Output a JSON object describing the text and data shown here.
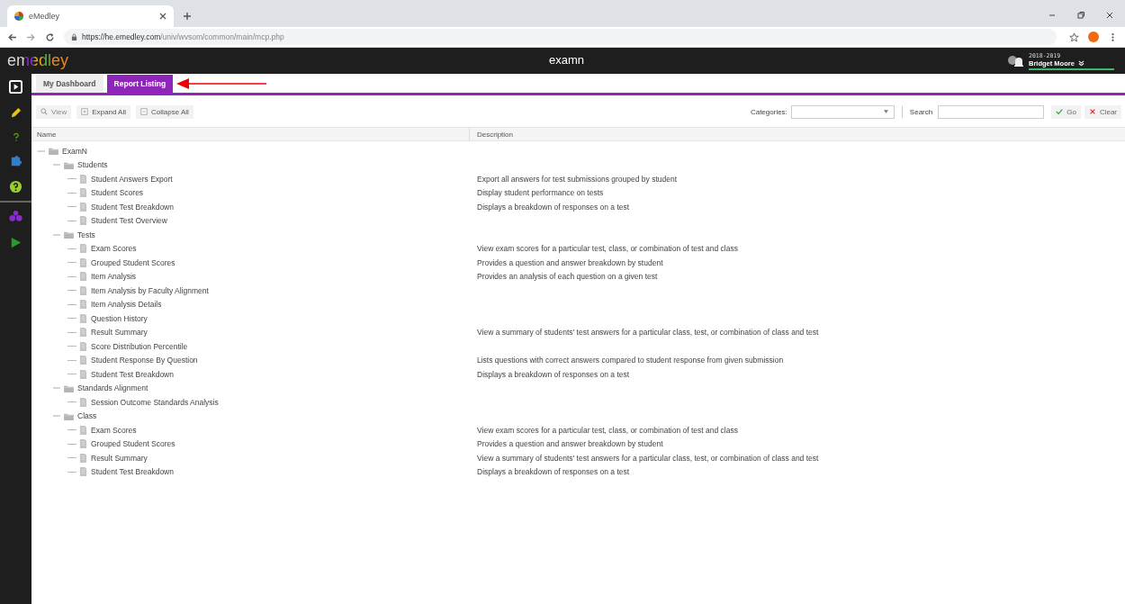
{
  "browser": {
    "tab": {
      "title": "eMedley"
    },
    "url": {
      "host": "https://he.emedley.com",
      "path": "/univ/wvsom/common/main/mcp.php"
    }
  },
  "app_header": {
    "logo": "emedley",
    "product": "examn",
    "user": {
      "year": "2018-2019",
      "name": "Bridget Moore"
    }
  },
  "tabs": [
    {
      "label": "My Dashboard",
      "selected": false
    },
    {
      "label": "Report Listing",
      "selected": true
    }
  ],
  "toolbar": {
    "buttons": [
      {
        "label": "View",
        "kind": "view",
        "disabled": true
      },
      {
        "label": "Expand All",
        "kind": "expand",
        "disabled": false
      },
      {
        "label": "Collapse All",
        "kind": "collapse",
        "disabled": false
      }
    ],
    "categories_label": "Categories:",
    "search_label": "Search",
    "go": "Go",
    "clear": "Clear"
  },
  "table": {
    "columns": [
      "Name",
      "Description"
    ],
    "tree": [
      {
        "label": "ExamN",
        "kind": "folder",
        "expanded": true,
        "children": [
          {
            "label": "Students",
            "kind": "folder",
            "expanded": true,
            "children": [
              {
                "label": "Student Answers Export",
                "kind": "report",
                "description": "Export all answers for test submissions grouped by student"
              },
              {
                "label": "Student Scores",
                "kind": "report",
                "description": "Display student performance on tests"
              },
              {
                "label": "Student Test Breakdown",
                "kind": "report",
                "description": "Displays a breakdown of responses on a test"
              },
              {
                "label": "Student Test Overview",
                "kind": "report"
              }
            ]
          },
          {
            "label": "Tests",
            "kind": "folder",
            "expanded": true,
            "children": [
              {
                "label": "Exam Scores",
                "kind": "report",
                "description": "View exam scores for a particular test, class, or combination of test and class"
              },
              {
                "label": "Grouped Student Scores",
                "kind": "report",
                "description": "Provides a question and answer breakdown by student"
              },
              {
                "label": "Item Analysis",
                "kind": "report",
                "description": "Provides an analysis of each question on a given test"
              },
              {
                "label": "Item Analysis by Faculty Alignment",
                "kind": "report"
              },
              {
                "label": "Item Analysis Details",
                "kind": "report"
              },
              {
                "label": "Question History",
                "kind": "report"
              },
              {
                "label": "Result Summary",
                "kind": "report",
                "description": "View a summary of students' test answers for a particular class, test, or combination of class and test"
              },
              {
                "label": "Score Distribution Percentile",
                "kind": "report"
              },
              {
                "label": "Student Response By Question",
                "kind": "report",
                "description": "Lists questions with correct answers compared to student response from given submission"
              },
              {
                "label": "Student Test Breakdown",
                "kind": "report",
                "description": "Displays a breakdown of responses on a test"
              }
            ]
          },
          {
            "label": "Standards Alignment",
            "kind": "folder",
            "expanded": true,
            "children": [
              {
                "label": "Session Outcome Standards Analysis",
                "kind": "report"
              }
            ]
          },
          {
            "label": "Class",
            "kind": "folder",
            "expanded": true,
            "children": [
              {
                "label": "Exam Scores",
                "kind": "report",
                "description": "View exam scores for a particular test, class, or combination of test and class"
              },
              {
                "label": "Grouped Student Scores",
                "kind": "report",
                "description": "Provides a question and answer breakdown by student"
              },
              {
                "label": "Result Summary",
                "kind": "report",
                "description": "View a summary of students' test answers for a particular class, test, or combination of class and test"
              },
              {
                "label": "Student Test Breakdown",
                "kind": "report",
                "description": "Displays a breakdown of responses on a test"
              }
            ]
          }
        ]
      }
    ]
  }
}
